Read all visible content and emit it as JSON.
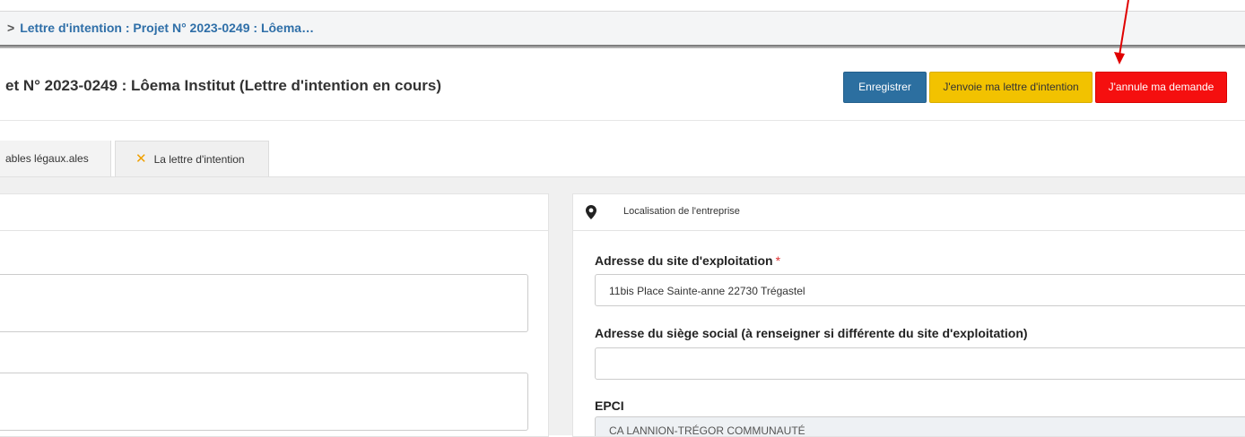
{
  "breadcrumb": {
    "text": "Lettre d'intention : Projet N° 2023-0249 : Lôema…"
  },
  "page": {
    "title": "et N° 2023-0249 : Lôema Institut (Lettre d'intention en cours)"
  },
  "actions": {
    "save_label": "Enregistrer",
    "send_label": "J'envoie ma lettre d'intention",
    "cancel_label": "J'annule ma demande"
  },
  "tabs": [
    {
      "label": "ables légaux.ales"
    },
    {
      "label": "La lettre d'intention"
    }
  ],
  "location_panel": {
    "title": "Localisation de l'entreprise",
    "site_label": "Adresse du site d'exploitation",
    "required_mark": "*",
    "site_value": "11bis Place Sainte-anne 22730 Trégastel",
    "hq_label": "Adresse du siège social (à renseigner si différente du site d'exploitation)",
    "hq_value": "",
    "epci_label": "EPCI",
    "epci_value": "CA LANNION-TRÉGOR COMMUNAUTÉ"
  },
  "colors": {
    "save": "#2c6fa0",
    "send": "#f2c200",
    "cancel": "#f50f0f",
    "link": "#2f6fa8",
    "annotation_arrow": "#e00000"
  },
  "icons": [
    "chevron-right-icon",
    "tools-icon",
    "map-marker-icon",
    "annotation-arrow"
  ]
}
